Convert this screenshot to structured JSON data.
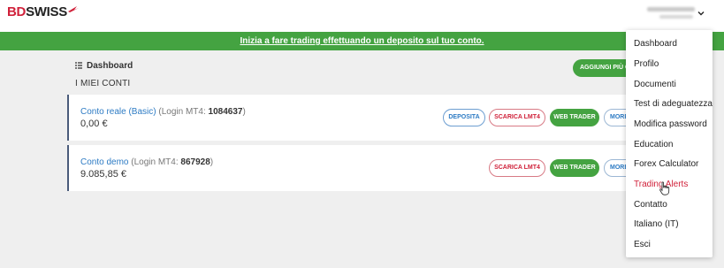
{
  "header": {
    "logo_bd": "BD",
    "logo_swiss": "SWISS",
    "user_name_blurred": "",
    "user_sub_blurred": ""
  },
  "banner": {
    "text": "Inizia a fare trading effettuando un deposito sul tuo conto."
  },
  "main": {
    "breadcrumb": "Dashboard",
    "section_title": "I MIEI CONTI",
    "add_button": "AGGIUNGI PIÙ CONTI",
    "accounts": [
      {
        "name": "Conto reale (Basic)",
        "login_label": "(Login MT4: ",
        "login_number": "1084637",
        "login_close": ")",
        "balance": "0,00 €",
        "buttons": [
          "DEPOSITA",
          "SCARICA LMT4",
          "WEB TRADER",
          "MORE"
        ]
      },
      {
        "name": "Conto demo",
        "login_label": "(Login MT4: ",
        "login_number": "867928",
        "login_close": ")",
        "balance": "9.085,85 €",
        "buttons": [
          "SCARICA LMT4",
          "WEB TRADER",
          "MORE"
        ]
      }
    ]
  },
  "dropdown": {
    "items": [
      {
        "label": "Dashboard"
      },
      {
        "label": "Profilo"
      },
      {
        "label": "Documenti"
      },
      {
        "label": "Test di adeguatezza"
      },
      {
        "label": "Modifica password"
      },
      {
        "label": "Education"
      },
      {
        "label": "Forex Calculator"
      },
      {
        "label": "Trading Alerts",
        "hovered": true
      },
      {
        "label": "Contatto"
      },
      {
        "label": "Italiano (IT)"
      },
      {
        "label": "Esci"
      }
    ]
  },
  "colors": {
    "brand_red": "#d0213a",
    "banner_green": "#44a341",
    "link_blue": "#2d7bc4",
    "card_accent": "#4a5b7a"
  },
  "icons": {
    "logo_flag": "flag-icon",
    "user_chevron": "chevron-down-icon",
    "breadcrumb": "grid-list-icon",
    "pointer": "hand-pointer-icon"
  }
}
